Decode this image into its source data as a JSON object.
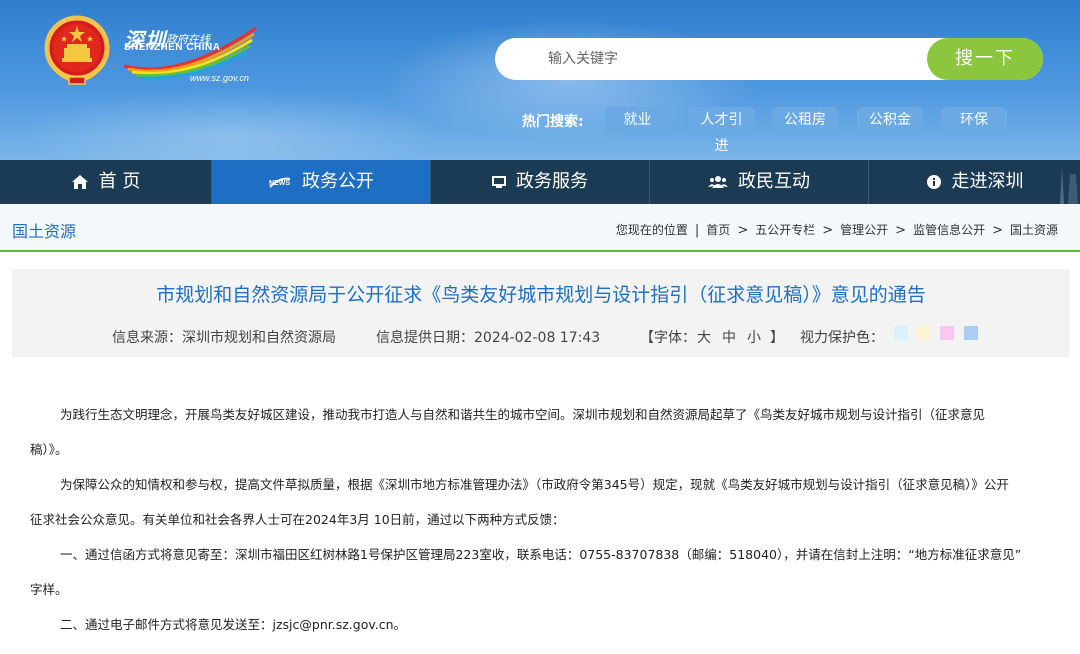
{
  "header": {
    "logo_cn": "深圳",
    "logo_sub": "政府在线",
    "logo_en": "SHENZHEN CHINA",
    "logo_url": "www.sz.gov.cn",
    "search_placeholder": "输入关键字",
    "search_button": "搜一下",
    "hot_label": "热门搜索:",
    "hot_tags": [
      "就业",
      "人才引进",
      "公租房",
      "公积金",
      "环保"
    ]
  },
  "nav": {
    "items": [
      {
        "label": "首 页",
        "icon": "home-icon"
      },
      {
        "label": "政务公开",
        "icon": "news-icon"
      },
      {
        "label": "政务服务",
        "icon": "monitor-icon"
      },
      {
        "label": "政民互动",
        "icon": "people-icon"
      },
      {
        "label": "走进深圳",
        "icon": "info-icon"
      }
    ],
    "active_index": 1
  },
  "subbar": {
    "title": "国土资源",
    "location_label": "您现在的位置",
    "crumbs": [
      "首页",
      "五公开专栏",
      "管理公开",
      "监管信息公开",
      "国土资源"
    ]
  },
  "article": {
    "title": "市规划和自然资源局于公开征求《鸟类友好城市规划与设计指引（征求意见稿）》意见的通告",
    "source": "信息来源：深圳市规划和自然资源局",
    "date": "信息提供日期：2024-02-08 17:43",
    "font_label": "【字体：",
    "font_big": "大",
    "font_mid": "中",
    "font_small": "小",
    "font_close": "】",
    "eye_label": "视力保护色：",
    "eye_colors": [
      "#d9f2fb",
      "#fbf5d6",
      "#f9c8ef",
      "#a9cdf4"
    ],
    "paragraphs": {
      "p1_l1": "为践行生态文明理念，开展鸟类友好城区建设，推动我市打造人与自然和谐共生的城市空间。深圳市规划和自然资源局起草了《鸟类友好城市规划与设计指引（征求意见",
      "p1_l2": "稿）》。",
      "p2_l1": "为保障公众的知情权和参与权，提高文件草拟质量，根据《深圳市地方标准管理办法》（市政府令第345号）规定，现就《鸟类友好城市规划与设计指引（征求意见稿）》公开",
      "p2_l2": "征求社会公众意见。有关单位和社会各界人士可在2024年3月 10日前，通过以下两种方式反馈：",
      "p3_l1": "一、通过信函方式将意见寄至：深圳市福田区红树林路1号保护区管理局223室收，联系电话：0755-83707838（邮编：518040），并请在信封上注明：“地方标准征求意见”",
      "p3_l2": "字样。",
      "p4_l1": "二、通过电子邮件方式将意见发送至：jzsjc@pnr.sz.gov.cn。"
    }
  }
}
